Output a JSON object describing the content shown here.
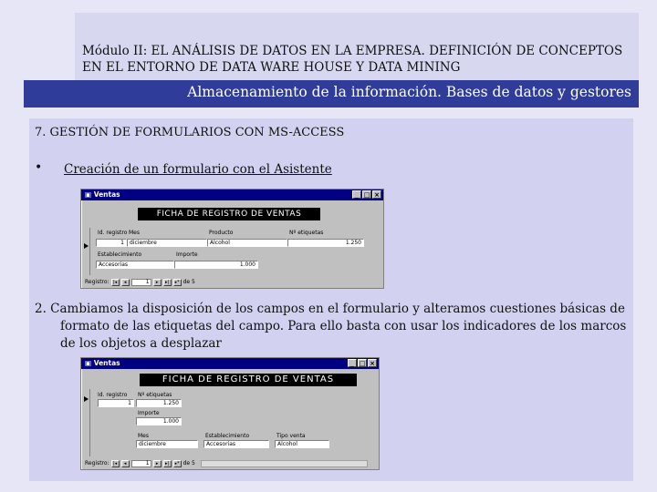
{
  "header": {
    "title": "Módulo II: EL ANÁLISIS DE DATOS EN LA EMPRESA. DEFINICIÓN DE CONCEPTOS EN EL ENTORNO DE DATA WARE HOUSE Y DATA MINING",
    "subtitle": "Almacenamiento de la información. Bases de datos y gestores"
  },
  "content": {
    "section_heading": "7. GESTIÓN DE FORMULARIOS CON MS-ACCESS",
    "bullet_symbol": "•",
    "bullet_text": "Creación de un formulario con el Asistente",
    "paragraph": "2. Cambiamos la disposición de los campos en el formulario y alteramos cuestiones básicas de formato de las etiquetas del campo. Para ello basta con usar los indicadores de los marcos de los objetos a desplazar"
  },
  "screenshot1": {
    "window_title": "Ventas",
    "form_header": "FICHA DE REGISTRO DE VENTAS",
    "labels": {
      "id": "Id. registro",
      "mes": "Mes",
      "producto": "Producto",
      "etiquetas": "Nº etiquetas",
      "establecimiento": "Establecimiento",
      "importe": "Importe"
    },
    "values": {
      "id": "1",
      "mes": "diciembre",
      "producto": "Alcohol",
      "etiquetas": "1.250",
      "establecimiento": "Accesorias",
      "importe": "1.000"
    },
    "nav": {
      "label": "Registro:",
      "current": "1",
      "total": "de 5"
    }
  },
  "screenshot2": {
    "window_title": "Ventas",
    "form_header": "FICHA DE REGISTRO DE VENTAS",
    "labels": {
      "id": "Id. registro",
      "etiquetas": "Nº etiquetas",
      "importe": "Importe",
      "mes": "Mes",
      "establecimiento": "Establecimiento",
      "tipo_venta": "Tipo venta"
    },
    "values": {
      "id": "1",
      "etiquetas": "1.250",
      "importe": "1.000",
      "mes": "diciembre",
      "establecimiento": "Accesorias",
      "tipo_venta": "Alcohol"
    },
    "nav": {
      "label": "Registro:",
      "current": "1",
      "total": "de 5"
    }
  }
}
